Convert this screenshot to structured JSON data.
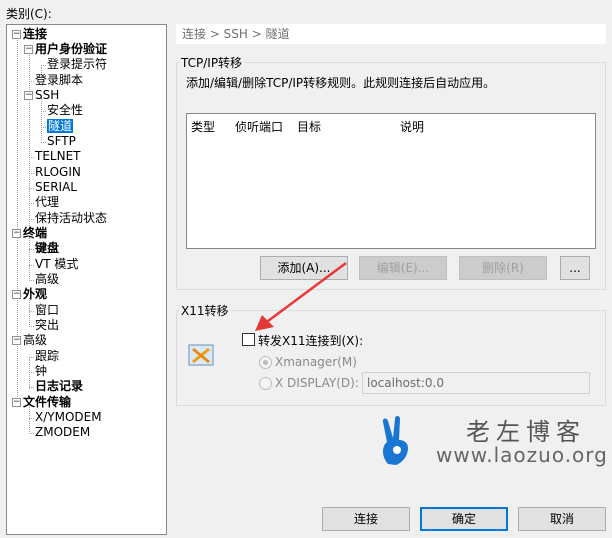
{
  "category_label": "类别(C):",
  "tree": [
    {
      "label": "连接",
      "bold": true
    },
    {
      "label": "用户身份验证",
      "bold": true
    },
    {
      "label": "登录提示符",
      "bold": false
    },
    {
      "label": "登录脚本",
      "bold": false
    },
    {
      "label": "SSH",
      "bold": false
    },
    {
      "label": "安全性",
      "bold": false
    },
    {
      "label": "隧道",
      "bold": false,
      "selected": true
    },
    {
      "label": "SFTP",
      "bold": false
    },
    {
      "label": "TELNET",
      "bold": false
    },
    {
      "label": "RLOGIN",
      "bold": false
    },
    {
      "label": "SERIAL",
      "bold": false
    },
    {
      "label": "代理",
      "bold": false
    },
    {
      "label": "保持活动状态",
      "bold": false
    },
    {
      "label": "终端",
      "bold": true
    },
    {
      "label": "键盘",
      "bold": true
    },
    {
      "label": "VT 模式",
      "bold": false
    },
    {
      "label": "高级",
      "bold": false
    },
    {
      "label": "外观",
      "bold": true
    },
    {
      "label": "窗口",
      "bold": false
    },
    {
      "label": "突出",
      "bold": false
    },
    {
      "label": "高级",
      "bold": false
    },
    {
      "label": "跟踪",
      "bold": false
    },
    {
      "label": "钟",
      "bold": false
    },
    {
      "label": "日志记录",
      "bold": true
    },
    {
      "label": "文件传输",
      "bold": true
    },
    {
      "label": "X/YMODEM",
      "bold": false
    },
    {
      "label": "ZMODEM",
      "bold": false
    }
  ],
  "breadcrumb": "连接 > SSH > 隧道",
  "tcp": {
    "title": "TCP/IP转移",
    "description": "添加/编辑/删除TCP/IP转移规则。此规则连接后自动应用。",
    "columns": [
      "类型",
      "侦听端口",
      "目标",
      "说明"
    ],
    "add": "添加(A)...",
    "edit": "编辑(E)...",
    "delete": "删除(R)",
    "more": "..."
  },
  "x11": {
    "title": "X11转移",
    "forward_label": "转发X11连接到(X):",
    "forward_checked": false,
    "xmanager": "Xmanager(M)",
    "xdisplay": "X DISPLAY(D):",
    "display_value": "localhost:0.0"
  },
  "watermark": {
    "title": "老左博客",
    "url": "www.laozuo.org"
  },
  "buttons": {
    "connect": "连接",
    "ok": "确定",
    "cancel": "取消"
  },
  "colors": {
    "selection": "#0078d7",
    "arrow": "#e53935",
    "watermark_blue": "#1976d2"
  }
}
